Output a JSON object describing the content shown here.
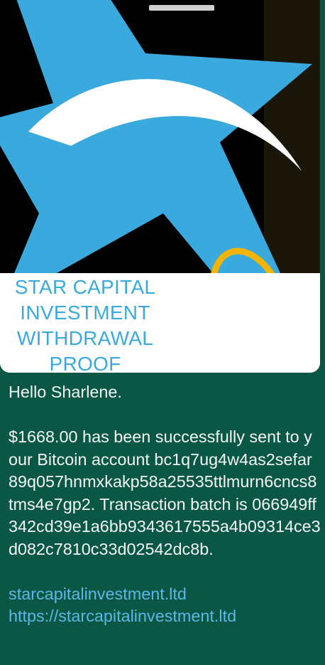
{
  "media": {
    "caption_lines": [
      "STAR CAPITAL",
      "INVESTMENT",
      "WITHDRAWAL",
      "PROOF"
    ],
    "colors": {
      "star_blue": "#39a9de",
      "background": "#000000",
      "swoosh": "#ffffff",
      "gold": "#f4b400"
    }
  },
  "message": {
    "greeting": "Hello Sharlene.",
    "body": "$1668.00 has been successfully sent to your Bitcoin account bc1q7ug4w4as2sefar89q057hnmxkakp58a25535ttlmurn6cncs8tms4e7gp2. Transaction batch is 066949ff342cd39e1a6bb9343617555a4b09314ce3d082c7810c33d02542dc8b.",
    "link1": "starcapitalinvestment.ltd",
    "link2": "https://starcapitalinvestment.ltd"
  },
  "colors": {
    "bubble_bg": "#0b5745",
    "text": "#f2f5f4",
    "link": "#5bb8e6"
  }
}
